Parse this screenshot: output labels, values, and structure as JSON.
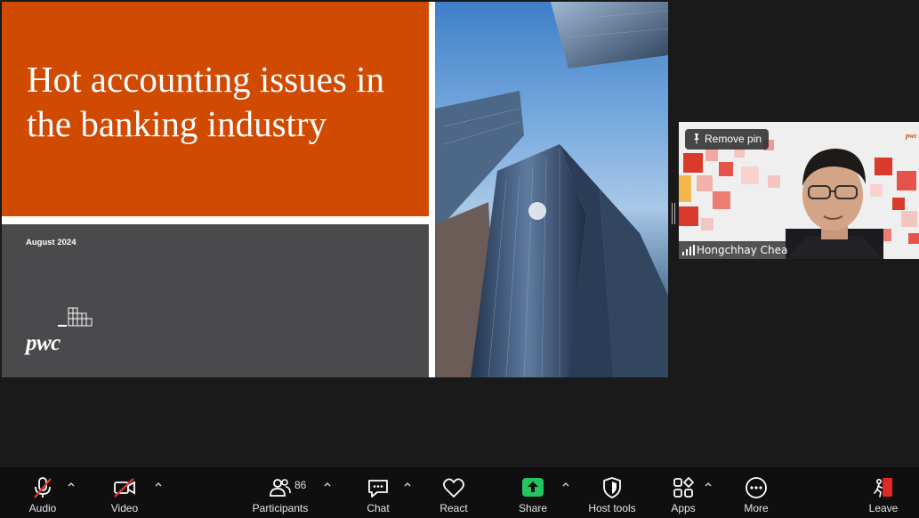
{
  "slide": {
    "title": "Hot accounting issues in the banking industry",
    "date": "August 2024",
    "logo_text": "pwc"
  },
  "participant": {
    "pin_label": "Remove pin",
    "name": "Hongchhay Chea"
  },
  "toolbar": {
    "audio": "Audio",
    "video": "Video",
    "participants": "Participants",
    "participants_count": "86",
    "chat": "Chat",
    "react": "React",
    "share": "Share",
    "host_tools": "Host tools",
    "apps": "Apps",
    "more": "More",
    "leave": "Leave"
  },
  "colors": {
    "brand_orange": "#d04a02",
    "share_green": "#22c55e",
    "leave_red": "#e02828",
    "muted_red": "#e0362c"
  },
  "icons": [
    "microphone-muted-icon",
    "video-off-icon",
    "participants-icon",
    "chat-icon",
    "react-heart-icon",
    "share-arrow-icon",
    "shield-icon",
    "apps-icon",
    "more-dots-icon",
    "leave-door-icon",
    "pin-icon",
    "signal-icon",
    "chevron-up-icon"
  ]
}
